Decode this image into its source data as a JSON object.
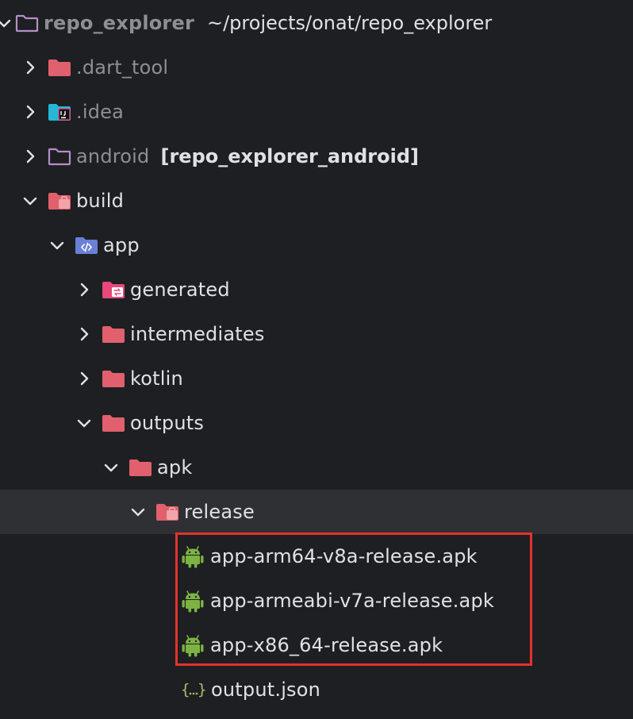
{
  "colors": {
    "background": "#1e1f22",
    "selected_row": "#2e3033",
    "text": "#dfe1e5",
    "dim_text": "#8c8f95",
    "folder_red": "#e0606e",
    "folder_pink_light": "#f2a5a9",
    "folder_outline_purple": "#b48ec8",
    "folder_blue": "#6a7fd6",
    "android_green": "#7cb342",
    "json_green": "#a8c066",
    "highlight_border": "#e5322d",
    "idea_cyan": "#26b6d6"
  },
  "tree": {
    "root": {
      "name": "repo_explorer",
      "path": "~/projects/onat/repo_explorer",
      "icon": "folder-outline-icon"
    },
    "items": [
      {
        "name": ".dart_tool",
        "icon": "folder-red-icon",
        "expanded": false
      },
      {
        "name": ".idea",
        "icon": "idea-folder-icon",
        "expanded": false
      },
      {
        "name": "android",
        "module": "[repo_explorer_android]",
        "icon": "folder-outline-icon",
        "expanded": false
      },
      {
        "name": "build",
        "icon": "folder-excluded-icon",
        "expanded": true
      },
      {
        "name": "app",
        "icon": "folder-source-icon",
        "expanded": true
      },
      {
        "name": "generated",
        "icon": "folder-generated-icon",
        "expanded": false
      },
      {
        "name": "intermediates",
        "icon": "folder-red-icon",
        "expanded": false
      },
      {
        "name": "kotlin",
        "icon": "folder-red-icon",
        "expanded": false
      },
      {
        "name": "outputs",
        "icon": "folder-red-icon",
        "expanded": true
      },
      {
        "name": "apk",
        "icon": "folder-red-icon",
        "expanded": true
      },
      {
        "name": "release",
        "icon": "folder-excluded-icon",
        "expanded": true,
        "selected": true
      },
      {
        "name": "app-arm64-v8a-release.apk",
        "icon": "android-icon"
      },
      {
        "name": "app-armeabi-v7a-release.apk",
        "icon": "android-icon"
      },
      {
        "name": "app-x86_64-release.apk",
        "icon": "android-icon"
      },
      {
        "name": "output.json",
        "icon": "json-icon"
      }
    ]
  }
}
